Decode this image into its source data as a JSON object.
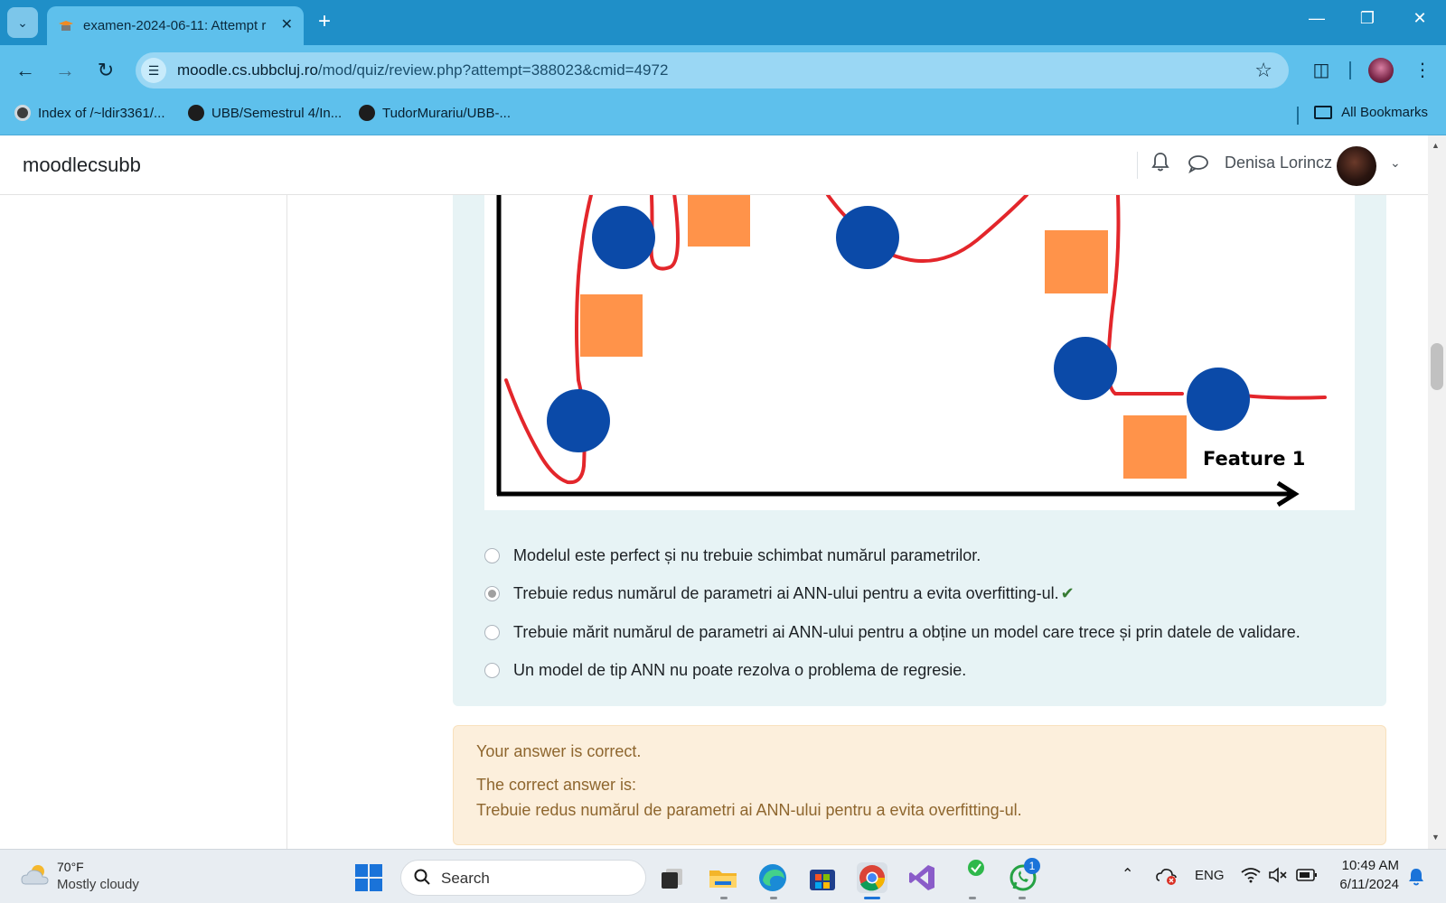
{
  "browser": {
    "tab_title": "examen-2024-06-11: Attempt r",
    "url_host": "moodle.cs.ubbcluj.ro",
    "url_path": "/mod/quiz/review.php?attempt=388023&cmid=4972",
    "bookmarks": [
      {
        "label": "Index of /~ldir3361/..."
      },
      {
        "label": "UBB/Semestrul 4/In..."
      },
      {
        "label": "TudorMurariu/UBB-..."
      }
    ],
    "all_bookmarks_label": "All Bookmarks"
  },
  "header": {
    "brand": "moodlecsubb",
    "user_name": "Denisa Lorincz"
  },
  "figure": {
    "axis_label": "Feature 1",
    "colors": {
      "circle": "#0b4aa8",
      "square": "#ff934a",
      "curve": "#e3262b"
    }
  },
  "question": {
    "options": [
      {
        "text": "Modelul este perfect și nu trebuie schimbat numărul parametrilor.",
        "selected": false
      },
      {
        "text": "Trebuie redus numărul de parametri ai ANN-ului pentru a evita overfitting-ul.",
        "selected": true,
        "correct": true
      },
      {
        "text": "Trebuie mărit numărul de parametri ai ANN-ului pentru a obține un model care trece și prin datele de validare.",
        "selected": false
      },
      {
        "text": "Un model de tip ANN nu poate rezolva o problema de regresie.",
        "selected": false
      }
    ]
  },
  "feedback": {
    "result": "Your answer is correct.",
    "correct_label": "The correct answer is:",
    "correct_answer": "Trebuie redus numărul de parametri ai ANN-ului pentru a evita overfitting-ul."
  },
  "taskbar": {
    "temperature": "70°F",
    "weather": "Mostly cloudy",
    "search_placeholder": "Search",
    "whatsapp_badge": "1",
    "language": "ENG",
    "time": "10:49 AM",
    "date": "6/11/2024"
  },
  "accent_colors": {
    "tabstrip": "#1f8fc8",
    "toolbar": "#5ec0ec",
    "feedback_bg": "#fcefdc",
    "question_bg": "#e7f3f5"
  }
}
